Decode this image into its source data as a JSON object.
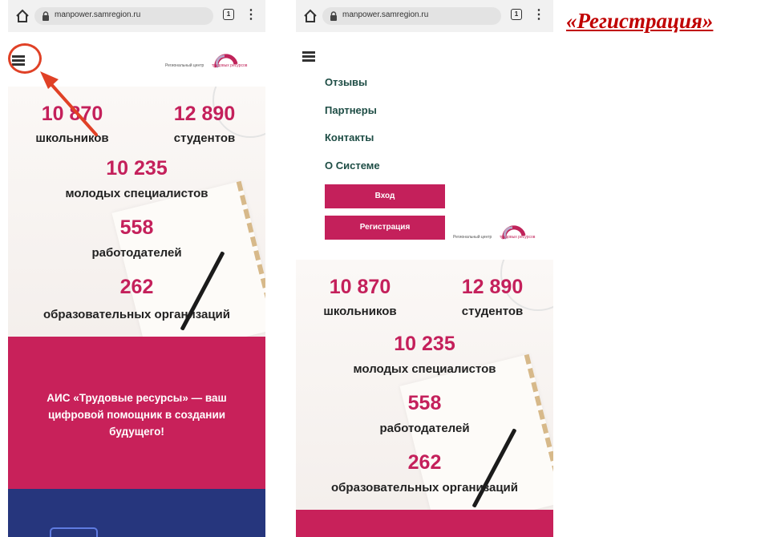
{
  "browser": {
    "url": "manpower.samregion.ru",
    "tabs_count": "1",
    "more": "⋮"
  },
  "logo": {
    "line1": "Региональный центр",
    "line2": "трудовых ресурсов"
  },
  "stats": [
    {
      "value": "10 870",
      "label": "школьников"
    },
    {
      "value": "12 890",
      "label": "студентов"
    },
    {
      "value": "10 235",
      "label": "молодых специалистов"
    },
    {
      "value": "558",
      "label": "работодателей"
    },
    {
      "value": "262",
      "label": "образовательных организаций"
    }
  ],
  "promo": {
    "text": "АИС «Трудовые ресурсы» — ваш цифровой помощник в создании будущего!"
  },
  "menu": {
    "items": [
      "Отзывы",
      "Партнеры",
      "Контакты",
      "О Системе"
    ],
    "login_label": "Вход",
    "register_label": "Регистрация"
  },
  "caption": "«Регистрация»",
  "colors": {
    "accent": "#c4205b",
    "promo_bg": "#c8215a",
    "blue_bg": "#26367d",
    "annotation": "#e04126",
    "caption": "#c00000"
  }
}
